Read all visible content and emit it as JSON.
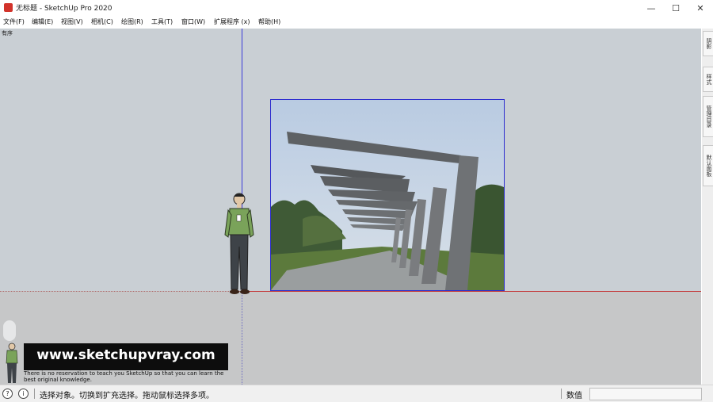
{
  "window": {
    "title": "无标题 - SketchUp Pro 2020",
    "minimize_icon": "minimize-icon",
    "maximize_icon": "maximize-icon",
    "close_icon": "close-icon"
  },
  "menu": {
    "items": [
      "文件(F)",
      "编辑(E)",
      "视图(V)",
      "相机(C)",
      "绘图(R)",
      "工具(T)",
      "窗口(W)",
      "扩展程序 (x)",
      "帮助(H)"
    ]
  },
  "viewport": {
    "scene_label": "有序",
    "colors": {
      "sky": "#c9cfd4",
      "ground": "#c6c7c8",
      "blue_axis": "#3b3bd9",
      "red_axis": "#c43a3a",
      "selection": "#2d2dcf"
    }
  },
  "watermark": {
    "url": "www.sketchupvray.com",
    "subtitle": "There is no reservation to teach you SketchUp so that you can learn the best original knowledge."
  },
  "trays": {
    "tabs": [
      "阴影",
      "样式",
      "管理目录",
      "默认面板"
    ]
  },
  "status": {
    "message": "选择对象。切换到扩充选择。拖动鼠标选择多项。",
    "measurements_label": "数值",
    "measurements_value": ""
  }
}
